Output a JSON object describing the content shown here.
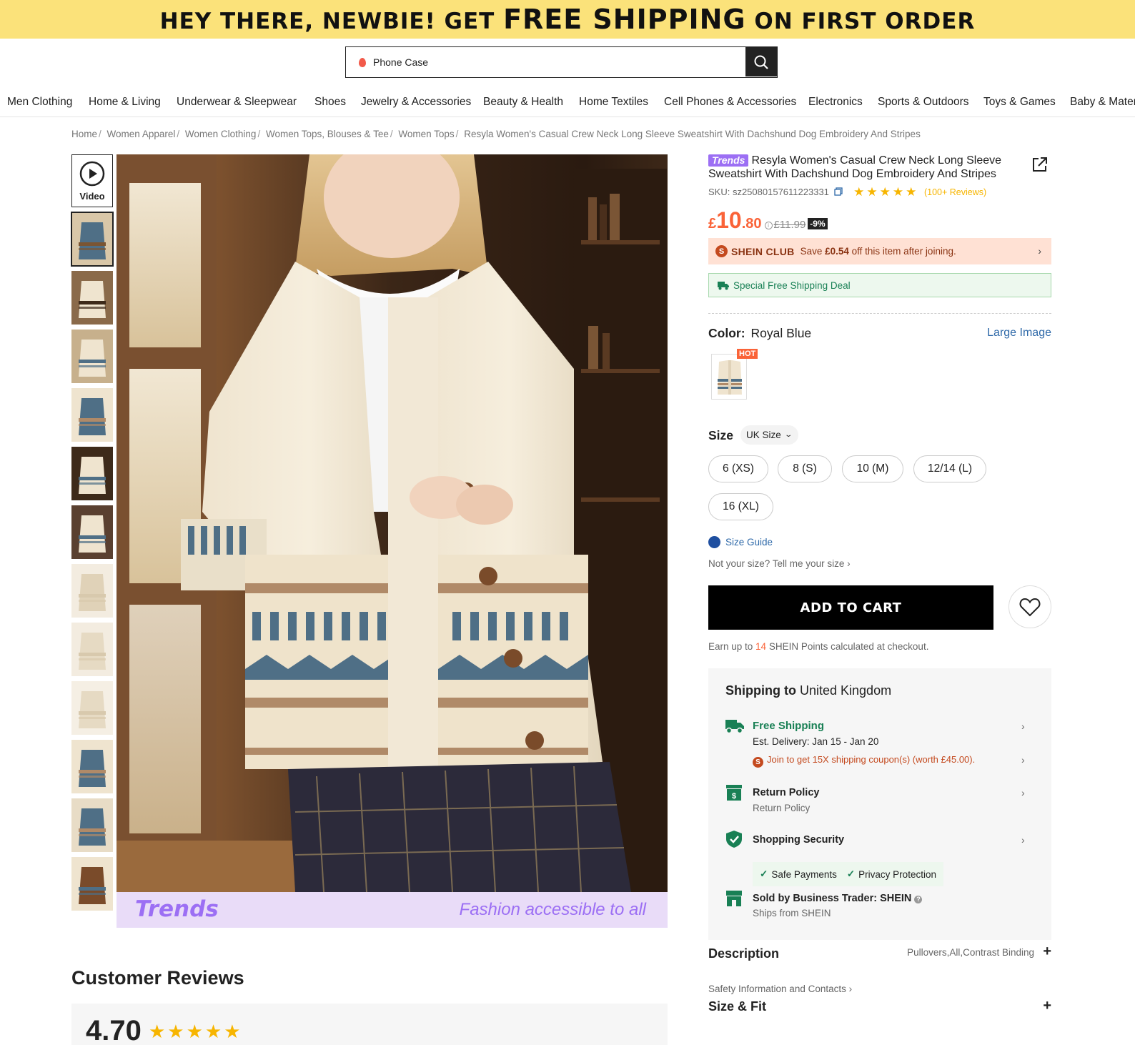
{
  "promo": {
    "part1": "HEY THERE, NEWBIE! GET ",
    "part2": "FREE SHIPPING",
    "part3": " ON FIRST ORDER"
  },
  "search": {
    "value": "Phone Case"
  },
  "categories": [
    "Men Clothing",
    "Home & Living",
    "Underwear & Sleepwear",
    "Shoes",
    "Jewelry & Accessories",
    "Beauty & Health",
    "Home Textiles",
    "Cell Phones & Accessories",
    "Electronics",
    "Sports & Outdoors",
    "Toys & Games",
    "Baby & Mater"
  ],
  "breadcrumb": [
    "Home",
    "Women Apparel",
    "Women Clothing",
    "Women Tops, Blouses & Tee",
    "Women Tops",
    "Resyla Women's Casual Crew Neck Long Sleeve Sweatshirt With Dachshund Dog Embroidery And Stripes"
  ],
  "gallery": {
    "video_label": "Video",
    "thumbnail_count": 12,
    "footer_logo": "Trends",
    "footer_tagline": "Fashion accessible to all"
  },
  "reviews": {
    "title": "Customer Reviews",
    "rating": "4.70",
    "stars": 4.7
  },
  "product": {
    "badge": "Trends",
    "title": "Resyla Women's Casual Crew Neck Long Sleeve Sweatshirt With Dachshund Dog Embroidery And Stripes",
    "sku": "SKU: sz25080157611223331",
    "stars": 4.5,
    "reviews_label": "(100+ Reviews)",
    "price_currency": "£",
    "price_int": "10",
    "price_dec": ".80",
    "price_info": "i",
    "price_original": "£11.99",
    "discount": "-9%"
  },
  "club": {
    "coin": "S",
    "name": "SHEIN CLUB",
    "text_prefix": "Save ",
    "amount": "£0.54",
    "text_suffix": " off this item after joining."
  },
  "shipping_deal": "Special Free Shipping Deal",
  "color": {
    "label": "Color:",
    "value": "Royal Blue",
    "large_image": "Large Image",
    "hot": "HOT"
  },
  "size": {
    "label": "Size",
    "selector": "UK Size",
    "options": [
      "6 (XS)",
      "8 (S)",
      "10 (M)",
      "12/14 (L)",
      "16 (XL)"
    ],
    "guide": "Size Guide",
    "not_your_size": "Not your size? Tell me your size"
  },
  "cart": {
    "add_label": "ADD TO CART",
    "points_prefix": "Earn up to ",
    "points_value": "14",
    "points_suffix": " SHEIN Points calculated at checkout."
  },
  "shipping": {
    "header_bold": "Shipping to",
    "header_country": "United Kingdom",
    "free_title": "Free Shipping",
    "delivery": "Est. Delivery: Jan 15 - Jan 20",
    "coupon_coin": "S",
    "coupon": "Join to get 15X shipping coupon(s) (worth £45.00).",
    "return_title": "Return Policy",
    "return_sub": "Return Policy",
    "security_title": "Shopping Security",
    "security_tags": [
      "Safe Payments",
      "Privacy Protection"
    ],
    "sold_by": "Sold by Business Trader: SHEIN",
    "ships_from": "Ships from SHEIN"
  },
  "description": {
    "title": "Description",
    "value": "Pullovers,All,Contrast Binding",
    "safety": "Safety Information and Contacts",
    "size_fit": "Size & Fit"
  },
  "colors": {
    "promo_bg": "#fbe27a",
    "price": "#fa6338",
    "trends_purple": "#9c6ff4",
    "link_blue": "#2d68a8",
    "green": "#198055",
    "star": "#f7b500"
  }
}
